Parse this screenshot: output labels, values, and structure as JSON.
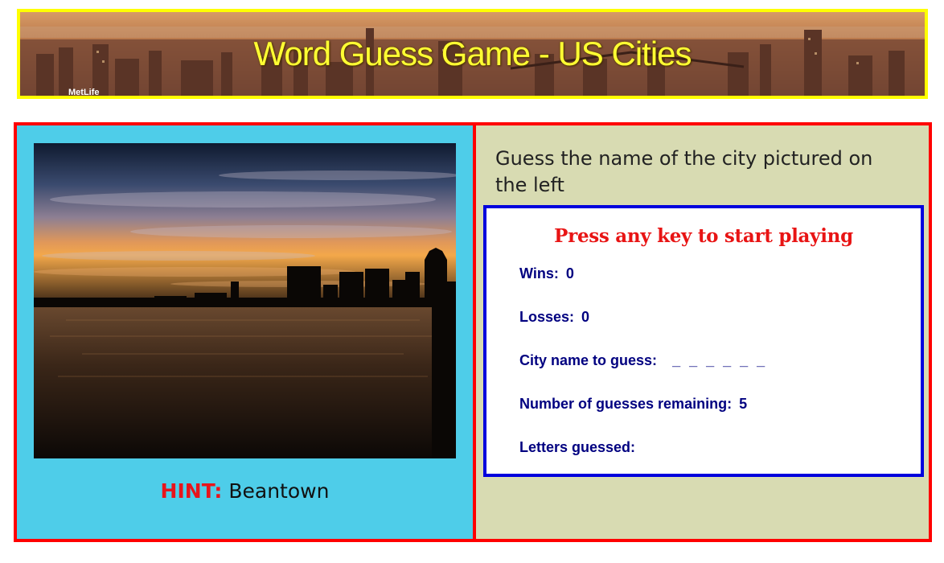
{
  "header": {
    "title": "Word Guess Game - US Cities",
    "sign_text": "MetLife"
  },
  "left": {
    "hint_label": "HINT:",
    "hint_value": "Beantown"
  },
  "right": {
    "instruction": "Guess the name of the city pictured on the left",
    "prompt": "Press any key to start playing",
    "wins_label": "Wins:",
    "wins_value": "0",
    "losses_label": "Losses:",
    "losses_value": "0",
    "word_label": "City name to guess:",
    "word_value": "_ _ _ _ _ _",
    "remaining_label": "Number of guesses remaining:",
    "remaining_value": "5",
    "letters_label": "Letters guessed:",
    "letters_value": ""
  },
  "colors": {
    "banner_border": "#ffff00",
    "main_border": "#ff0000",
    "left_bg": "#4ecde9",
    "right_bg": "#d8dbb2",
    "game_border": "#0000dd",
    "prompt_color": "#e81414",
    "stat_color": "#000080"
  },
  "icons": {
    "banner_image": "nyc-skyline-image",
    "city_photo": "boston-sunset-skyline-photo"
  }
}
